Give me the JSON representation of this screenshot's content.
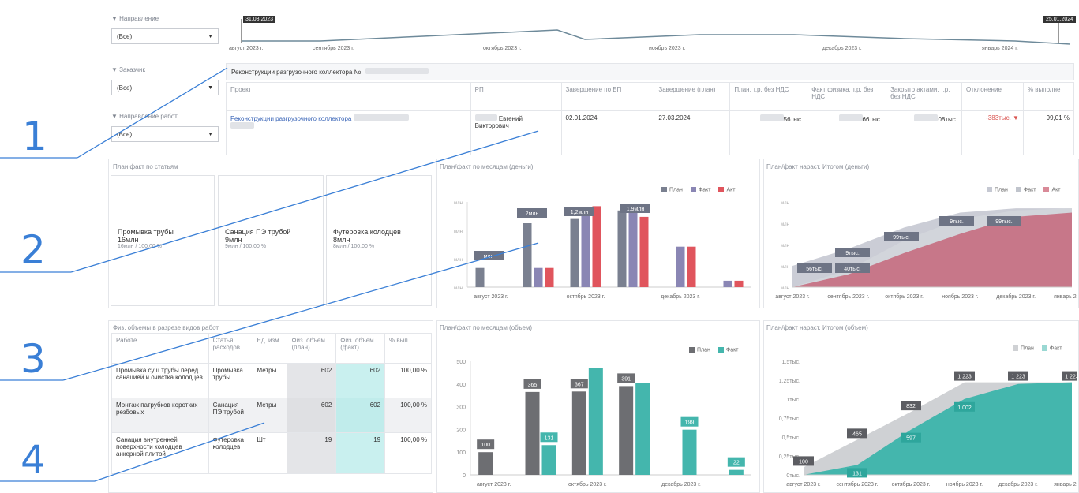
{
  "filters": [
    {
      "label": "▼ Направление",
      "value": "(Все)"
    },
    {
      "label": "▼ Заказчик",
      "value": "(Все)"
    },
    {
      "label": "▼ Направление работ",
      "value": "(Все)"
    }
  ],
  "timeline": {
    "start_date": "31.08.2023",
    "end_date": "25.01.2024",
    "months": [
      "август 2023 г.",
      "сентябрь 2023 г.",
      "октябрь 2023 г.",
      "ноябрь 2023 г.",
      "декабрь 2023 г.",
      "январь 2024 г."
    ]
  },
  "project": {
    "title": "Реконструкции разгрузочного коллектора №",
    "columns": [
      "Проект",
      "РП",
      "Завершение по БП",
      "Завершение (план)",
      "План, т.р. без НДС",
      "Факт физика, т.р. без НДС",
      "Закрыто актами, т.р. без НДС",
      "Отклонение",
      "% выполне"
    ],
    "row": {
      "project": "Реконструкции разгрузочного коллектора",
      "rp_name": "Евгений",
      "rp_patronymic": "Викторович",
      "end_bp": "02.01.2024",
      "end_plan": "27.03.2024",
      "plan": "56тыс.",
      "fact": "66тыс.",
      "acts": "08тыс.",
      "deviation": "-383тыс.",
      "percent": "99,01 %"
    }
  },
  "plan_fact_articles": {
    "title": "План факт по статьям",
    "cards": [
      {
        "name": "Промывка трубы",
        "value": "16млн",
        "sub": "16млн / 100,00 %"
      },
      {
        "name": "Санация ПЭ трубой",
        "value": "9млн",
        "sub": "9млн / 100,00 %"
      },
      {
        "name": "Футеровка колодцев",
        "value": "8млн",
        "sub": "8млн / 100,00 %"
      }
    ]
  },
  "works_table": {
    "title": "Физ. объемы в разрезе видов работ",
    "columns": [
      "Работе",
      "Статья расходов",
      "Ед. изм.",
      "Физ. объем (план)",
      "Физ. объем (факт)",
      "% вып."
    ],
    "rows": [
      {
        "work": "Промывка сущ трубы перед санацией и очистка колодцев",
        "article": "Промывка трубы",
        "unit": "Метры",
        "plan": "602",
        "fact": "602",
        "pct": "100,00 %"
      },
      {
        "work": "Монтаж патрубков коротких резбовых",
        "article": "Санация ПЭ трубой",
        "unit": "Метры",
        "plan": "602",
        "fact": "602",
        "pct": "100,00 %"
      },
      {
        "work": "Санация внутренней поверхности колодцев анкерной плитой",
        "article": "Футеровка колодцев",
        "unit": "Шт",
        "plan": "19",
        "fact": "19",
        "pct": "100,00 %"
      }
    ]
  },
  "chart_titles": {
    "money_monthly": "План/факт по месяцам (деньги)",
    "money_cumulative": "План/факт нараст. Итогом (деньги)",
    "volume_monthly": "План/факт по месяцам (объем)",
    "volume_cumulative": "План/факт нараст. Итогом (объем)"
  },
  "legends": {
    "plan": "План",
    "fact": "Факт",
    "act": "Акт"
  },
  "colors": {
    "plan": "#7a8090",
    "fact": "#8a86b4",
    "act": "#e0555d",
    "teal": "#44b6ad",
    "link": "#3b66b8",
    "annotation": "#3a7fd6"
  },
  "chart_data": [
    {
      "type": "bar",
      "title": "План/факт по месяцам (деньги)",
      "categories": [
        "август 2023 г.",
        "сентябрь 2023 г.",
        "октябрь 2023 г.",
        "ноябрь 2023 г.",
        "декабрь 2023 г.",
        "январь 2024 г."
      ],
      "tick_labels": [
        "август 2023 г.",
        "октябрь 2023 г.",
        "декабрь 2023 г."
      ],
      "series": [
        {
          "name": "План",
          "values": [
            0.9,
            3.0,
            3.2,
            3.6,
            0,
            0
          ]
        },
        {
          "name": "Факт",
          "values": [
            0,
            0.9,
            3.7,
            3.5,
            1.9,
            0.3
          ]
        },
        {
          "name": "Акт",
          "values": [
            0,
            0.9,
            3.8,
            3.3,
            1.9,
            0.3
          ]
        }
      ],
      "data_labels": [
        "млн",
        "2млн",
        "1,2млн",
        "1,9млн"
      ],
      "legend": "top-right"
    },
    {
      "type": "area",
      "title": "План/факт нараст. Итогом (деньги)",
      "x": [
        "август 2023 г.",
        "сентябрь 2023 г.",
        "октябрь 2023 г.",
        "ноябрь 2023 г.",
        "декабрь 2023 г.",
        "январь 2024 г."
      ],
      "series": [
        {
          "name": "План",
          "values": [
            1.0,
            1.8,
            2.8,
            3.5,
            3.7,
            3.7
          ]
        },
        {
          "name": "Факт",
          "values": [
            0,
            0.8,
            2.2,
            3.2,
            3.6,
            3.7
          ]
        },
        {
          "name": "Акт",
          "values": [
            0,
            0.6,
            1.6,
            2.5,
            3.3,
            3.5
          ]
        }
      ],
      "data_labels": [
        "56тыс.",
        "40тыс.",
        "9тыс.",
        "99тыс.",
        "9тыс.",
        "99тыс."
      ],
      "legend": "top-right"
    },
    {
      "type": "bar",
      "title": "План/факт по месяцам (объем)",
      "categories": [
        "август 2023 г.",
        "сентябрь 2023 г.",
        "октябрь 2023 г.",
        "ноябрь 2023 г.",
        "декабрь 2023 г.",
        "январь 2024 г."
      ],
      "tick_labels": [
        "август 2023 г.",
        "октябрь 2023 г.",
        "декабрь 2023 г."
      ],
      "y_ticks": [
        "0",
        "100",
        "200",
        "300",
        "400",
        "500"
      ],
      "ylim": [
        0,
        500
      ],
      "series": [
        {
          "name": "План",
          "values": [
            100,
            365,
            367,
            391,
            0,
            0
          ]
        },
        {
          "name": "Факт",
          "values": [
            0,
            131,
            470,
            405,
            199,
            22
          ]
        }
      ],
      "value_labels": {
        "План": [
          "100",
          "365",
          "367",
          "391",
          "",
          ""
        ],
        "Факт": [
          "",
          "131",
          "",
          "",
          "199",
          "22"
        ]
      },
      "legend": "top-right"
    },
    {
      "type": "area",
      "title": "План/факт нараст. Итогом (объем)",
      "x": [
        "август 2023 г.",
        "сентябрь 2023 г.",
        "октябрь 2023 г.",
        "ноябрь 2023 г.",
        "декабрь 2023 г.",
        "январь 2024 г."
      ],
      "y_ticks": [
        "0тыс.",
        "0,25тыс.",
        "0,5тыс.",
        "0,75тыс.",
        "1тыс.",
        "1,25тыс.",
        "1,5тыс."
      ],
      "ylim": [
        0,
        1500
      ],
      "series": [
        {
          "name": "План",
          "values": [
            100,
            465,
            832,
            1223,
            1223,
            1223
          ]
        },
        {
          "name": "Факт",
          "values": [
            0,
            131,
            597,
            1002,
            1201,
            1223
          ]
        }
      ],
      "value_labels": {
        "План": [
          "100",
          "465",
          "832",
          "1 223",
          "1 223",
          "1 223"
        ],
        "Факт": [
          "",
          "131",
          "597",
          "1 002",
          "",
          ""
        ]
      },
      "legend": "top-right"
    }
  ],
  "annotations": [
    "1",
    "2",
    "3",
    "4"
  ]
}
